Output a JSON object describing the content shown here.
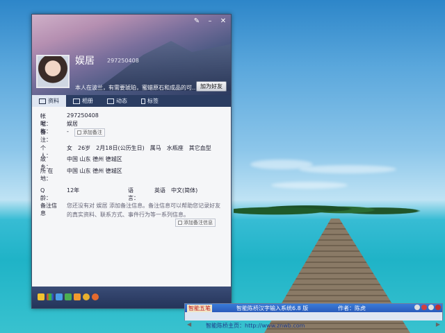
{
  "window": {
    "nickname": "娱居",
    "qq_number": "297250408",
    "signature": "本人在波兰，有需要琥珀，蜜蜡原石和成品的可…",
    "add_friend_label": "加为好友",
    "title_buttons": [
      "✎",
      "–",
      "✕"
    ]
  },
  "tabs": [
    {
      "label": "资料",
      "icon": "profile-card-icon",
      "active": true
    },
    {
      "label": "相册",
      "icon": "photo-album-icon",
      "active": false
    },
    {
      "label": "动态",
      "icon": "feed-icon",
      "active": false
    },
    {
      "label": "标签",
      "icon": "bookmark-icon",
      "active": false
    }
  ],
  "profile": {
    "account_label": "帐　号：",
    "account_value": "297250408",
    "nickname_label": "昵　称：",
    "nickname_value": "娱居",
    "remark_label": "备　注：",
    "remark_value": "-",
    "add_remark_label": "添加备注",
    "personal_label": "个　人：",
    "personal_value": "女　26岁　2月18日(公历生日)　属马　水瓶座　其它血型",
    "hometown_label": "故　乡：",
    "hometown_value": "中国 山东 德州 德城区",
    "location_label": "所 在 地：",
    "location_value": "中国 山东 德州 德城区",
    "qage_label": "Q　龄：",
    "qage_value": "12年",
    "language_label": "语　言：",
    "language_value": "英语　中文(简体)",
    "remark_info_label": "备注信息",
    "remark_info_text_1": "您还没有对 娱居 添加备注信息。备注信息可以帮助您记录好友",
    "remark_info_text_2": "的真实资料、联系方式、事件行为等一系列信息。",
    "add_remark_info_label": "添加备注信息"
  },
  "ime": {
    "brand": "智能五笔",
    "name": "智能陈桥汉字输入系统6.8 版",
    "author": "作者：陈虎",
    "homepage": "智能陈桥主页：http://www.znwb.com"
  }
}
